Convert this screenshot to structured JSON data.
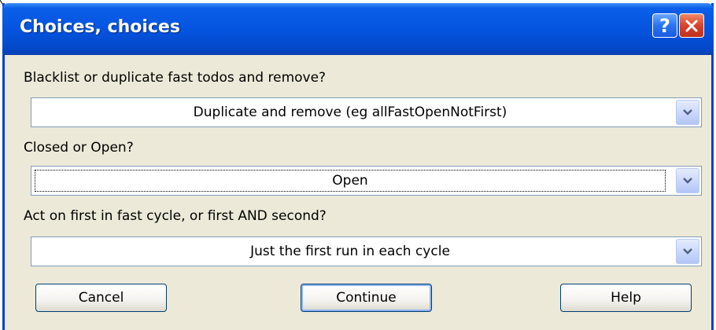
{
  "window": {
    "title": "Choices, choices",
    "help_glyph": "?",
    "help_icon": "question-mark-icon",
    "close_icon": "close-x-icon"
  },
  "questions": [
    {
      "label": "Blacklist or duplicate fast todos and remove?",
      "selected": "Duplicate and remove (eg allFastOpenNotFirst)"
    },
    {
      "label": "Closed or Open?",
      "selected": "Open"
    },
    {
      "label": "Act on first in fast cycle, or first AND second?",
      "selected": "Just the first run in each cycle"
    }
  ],
  "buttons": {
    "cancel": "Cancel",
    "continue": "Continue",
    "help": "Help"
  },
  "colors": {
    "titlebar": "#0554e0",
    "dialog_bg": "#ece9d8",
    "close_red": "#d8432a"
  }
}
